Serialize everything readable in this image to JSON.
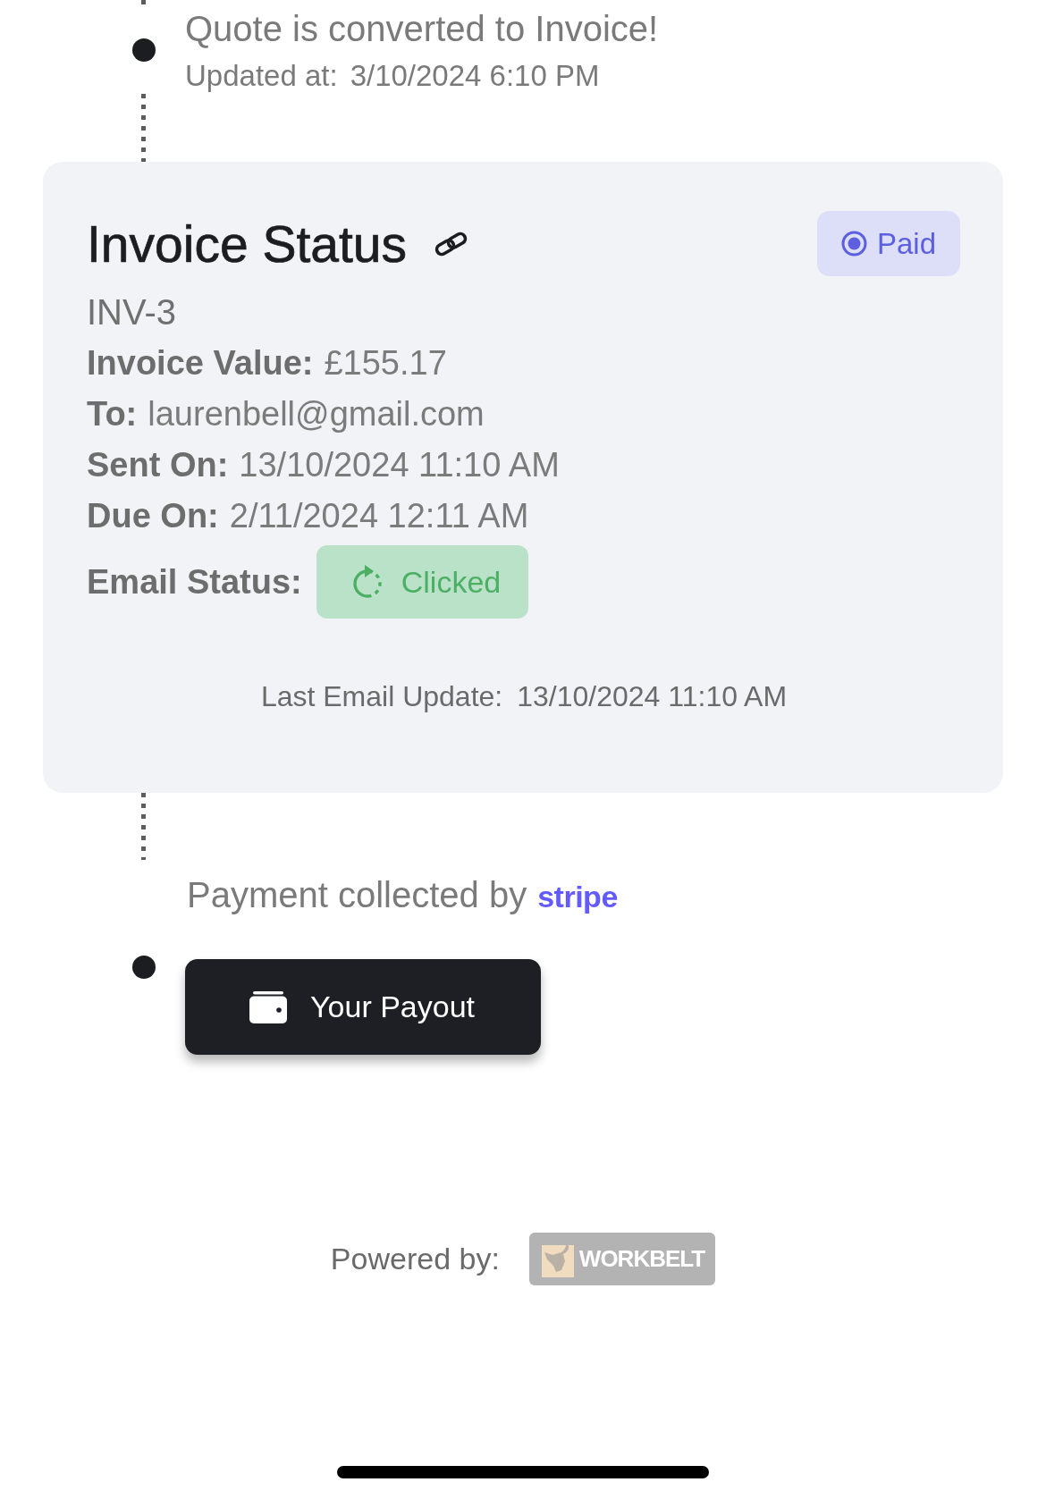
{
  "timeline_event": {
    "title": "Quote is converted to Invoice!",
    "updated_label": "Updated at:",
    "updated_value": "3/10/2024 6:10 PM"
  },
  "invoice_card": {
    "title": "Invoice Status",
    "status_badge": "Paid",
    "number": "INV-3",
    "fields": [
      {
        "label": "Invoice Value:",
        "value": "£155.17"
      },
      {
        "label": "To:",
        "value": "laurenbell@gmail.com"
      },
      {
        "label": "Sent On:",
        "value": "13/10/2024 11:10 AM"
      },
      {
        "label": "Due On:",
        "value": "2/11/2024 12:11 AM"
      }
    ],
    "email_status": {
      "label": "Email Status:",
      "value": "Clicked"
    },
    "last_email_update": {
      "label": "Last Email Update:",
      "value": "13/10/2024 11:10 AM"
    }
  },
  "payment": {
    "note": "Payment collected by",
    "provider": "stripe",
    "payout_button": "Your Payout"
  },
  "footer": {
    "label": "Powered by:",
    "logo_text": "WORKBELT"
  }
}
